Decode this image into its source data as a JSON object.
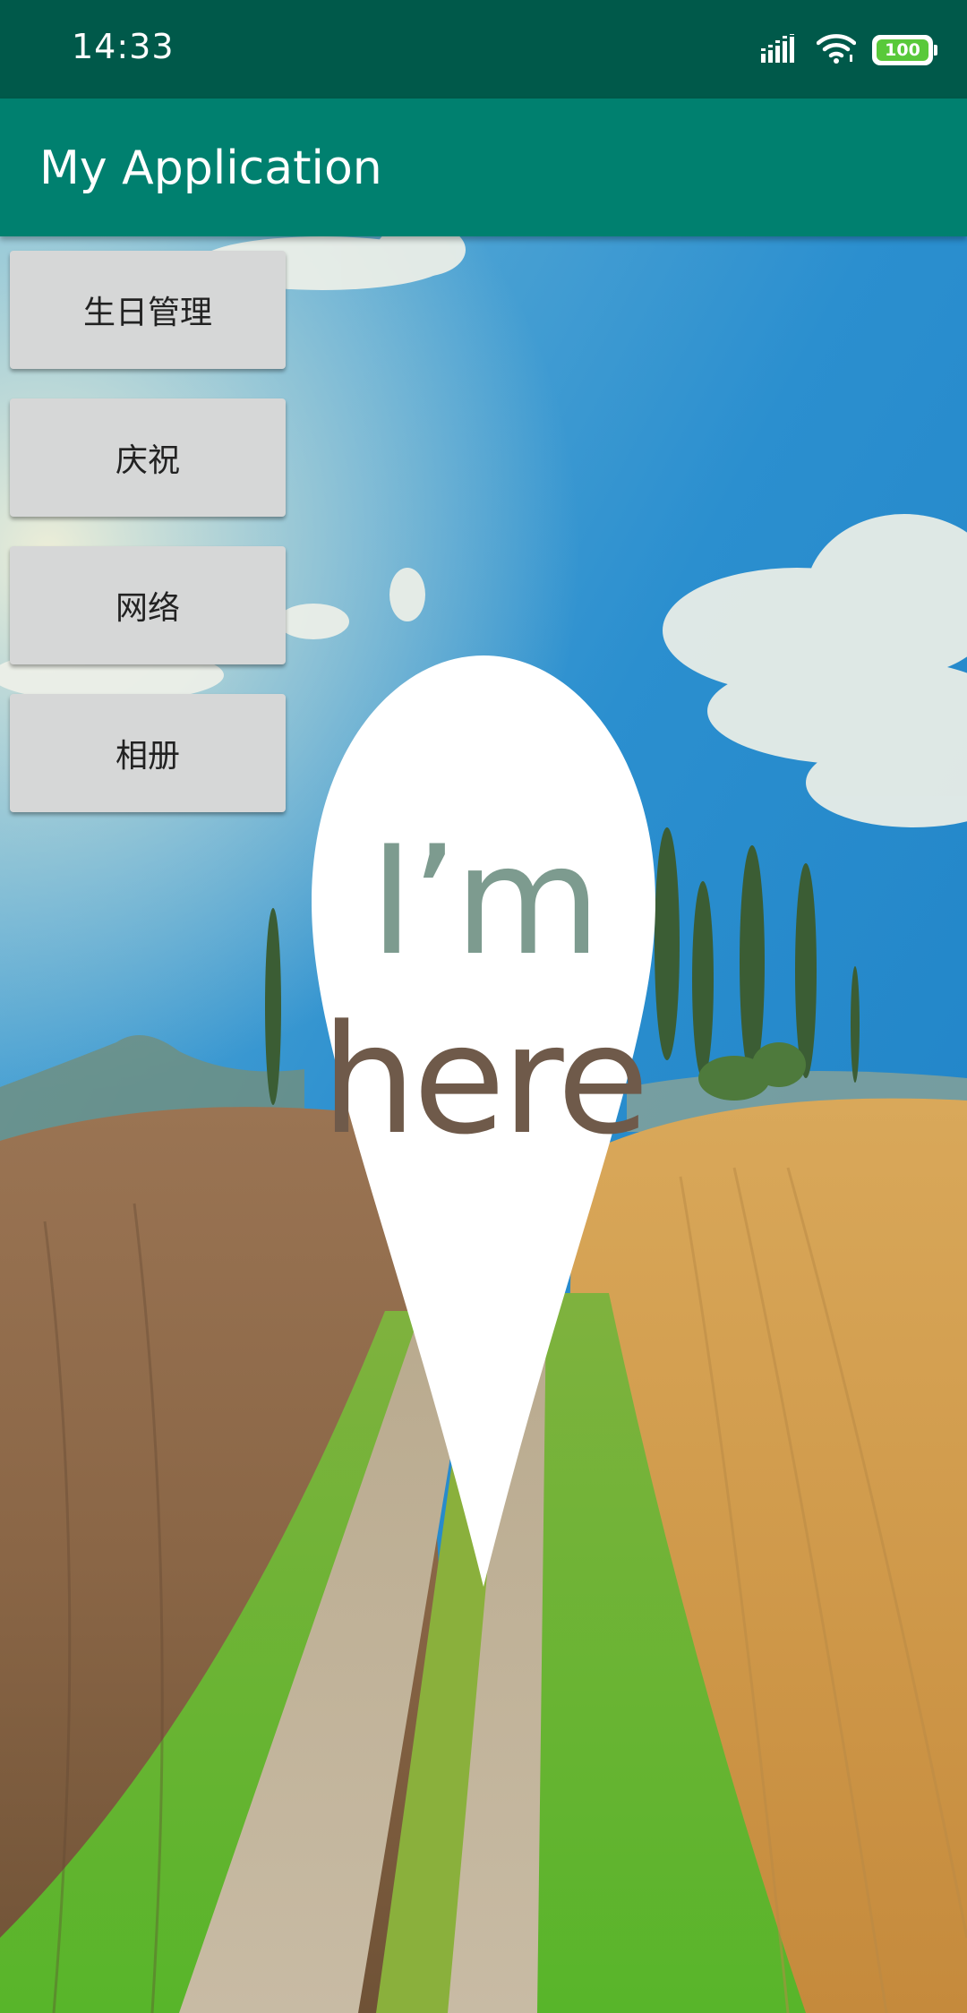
{
  "status_bar": {
    "time": "14:33",
    "battery": "100",
    "icons": [
      "signal-icon",
      "wifi-icon",
      "battery-icon"
    ]
  },
  "app_bar": {
    "title": "My Application"
  },
  "buttons": [
    {
      "label": "生日管理"
    },
    {
      "label": "庆祝"
    },
    {
      "label": "网络"
    },
    {
      "label": "相册"
    }
  ],
  "pin": {
    "line1": "I’m",
    "line2": "here"
  },
  "colors": {
    "status_bar": "#00594a",
    "app_bar": "#00806f",
    "button_bg": "#d6d7d7",
    "battery_fill": "#59c93a"
  }
}
